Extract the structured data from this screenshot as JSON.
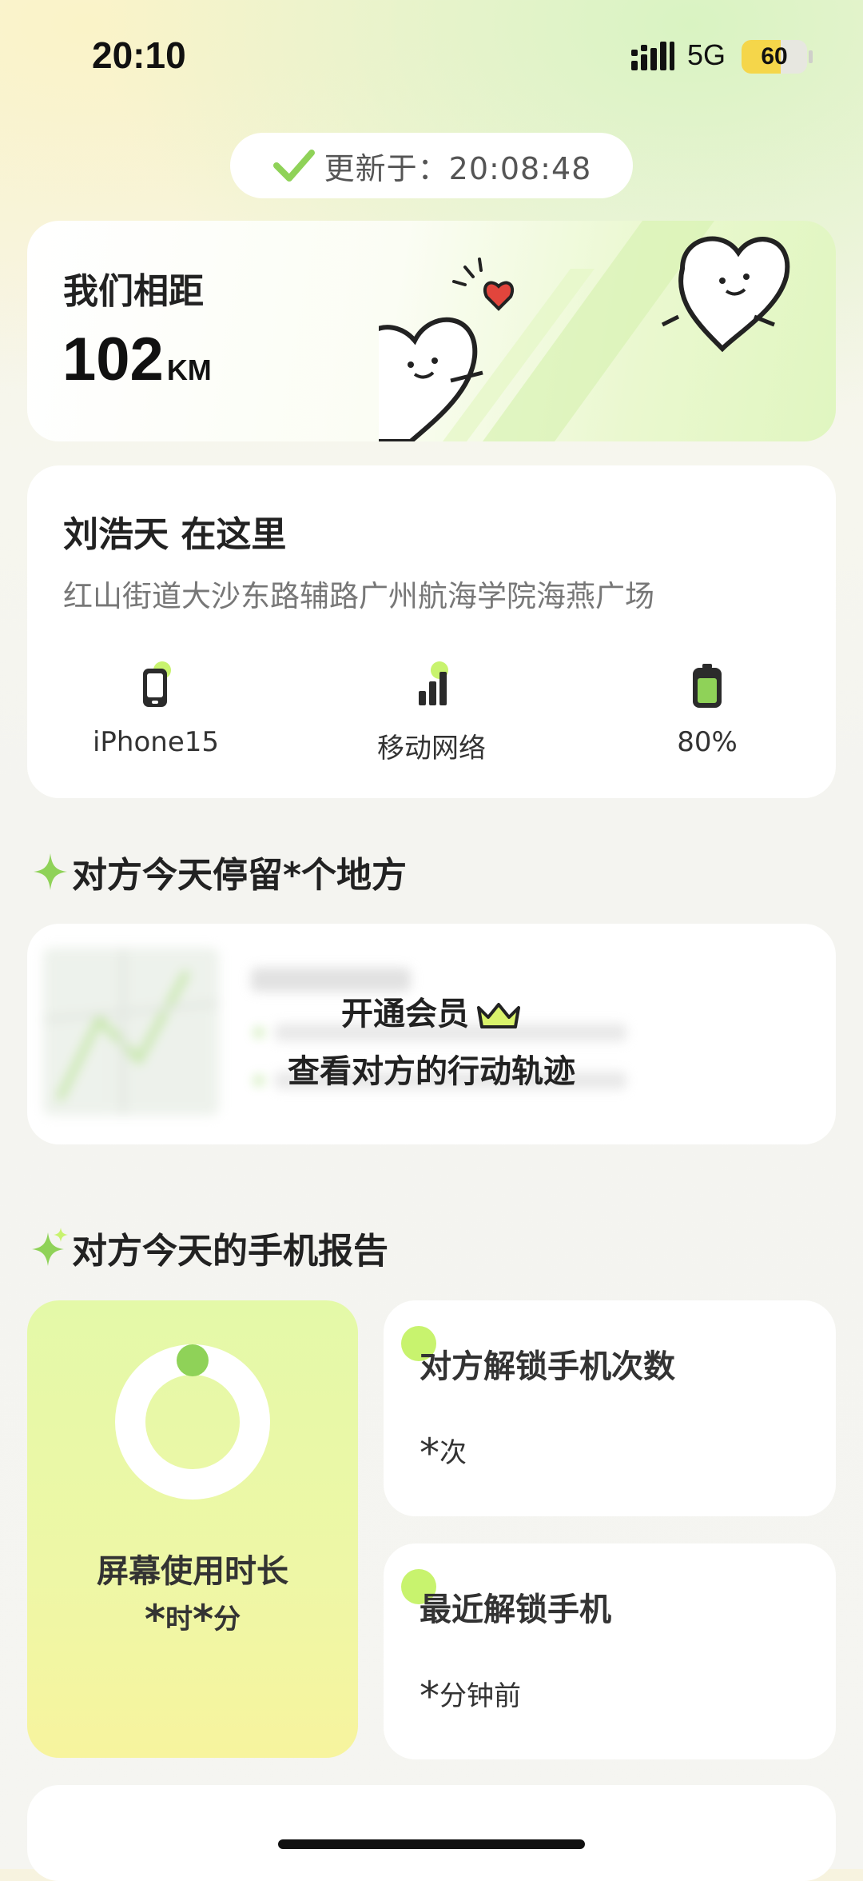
{
  "status_bar": {
    "time": "20:10",
    "network": "5G",
    "battery_level": "60",
    "battery_fraction": 0.6
  },
  "update": {
    "text": "更新于：20:08:48",
    "icon": "check-icon"
  },
  "distance": {
    "label": "我们相距",
    "value": "102",
    "unit": "KM"
  },
  "location": {
    "title": "刘浩天 在这里",
    "address": "红山街道大沙东路辅路广州航海学院海燕广场",
    "stats": [
      {
        "icon": "phone-icon",
        "label": "iPhone15"
      },
      {
        "icon": "signal-bars-icon",
        "label": "移动网络"
      },
      {
        "icon": "battery-icon",
        "label": "80%"
      }
    ]
  },
  "places_section": {
    "title": "对方今天停留*个地方",
    "cta_line1": "开通会员",
    "cta_line2": "查看对方的行动轨迹"
  },
  "report_section": {
    "title": "对方今天的手机报告",
    "screen_time": {
      "label": "屏幕使用时长",
      "hour_mask": "*",
      "hour_unit": "时",
      "minute_mask": "*",
      "minute_unit": "分"
    },
    "unlock_count": {
      "title": "对方解锁手机次数",
      "mask": "*",
      "unit": "次"
    },
    "last_unlock": {
      "title": "最近解锁手机",
      "mask": "*",
      "unit": "分钟前"
    }
  },
  "colors": {
    "accent_green": "#8fd258",
    "light_green": "#c8f36e",
    "heart_red": "#e2453c",
    "battery_yellow": "#f5d64a"
  }
}
